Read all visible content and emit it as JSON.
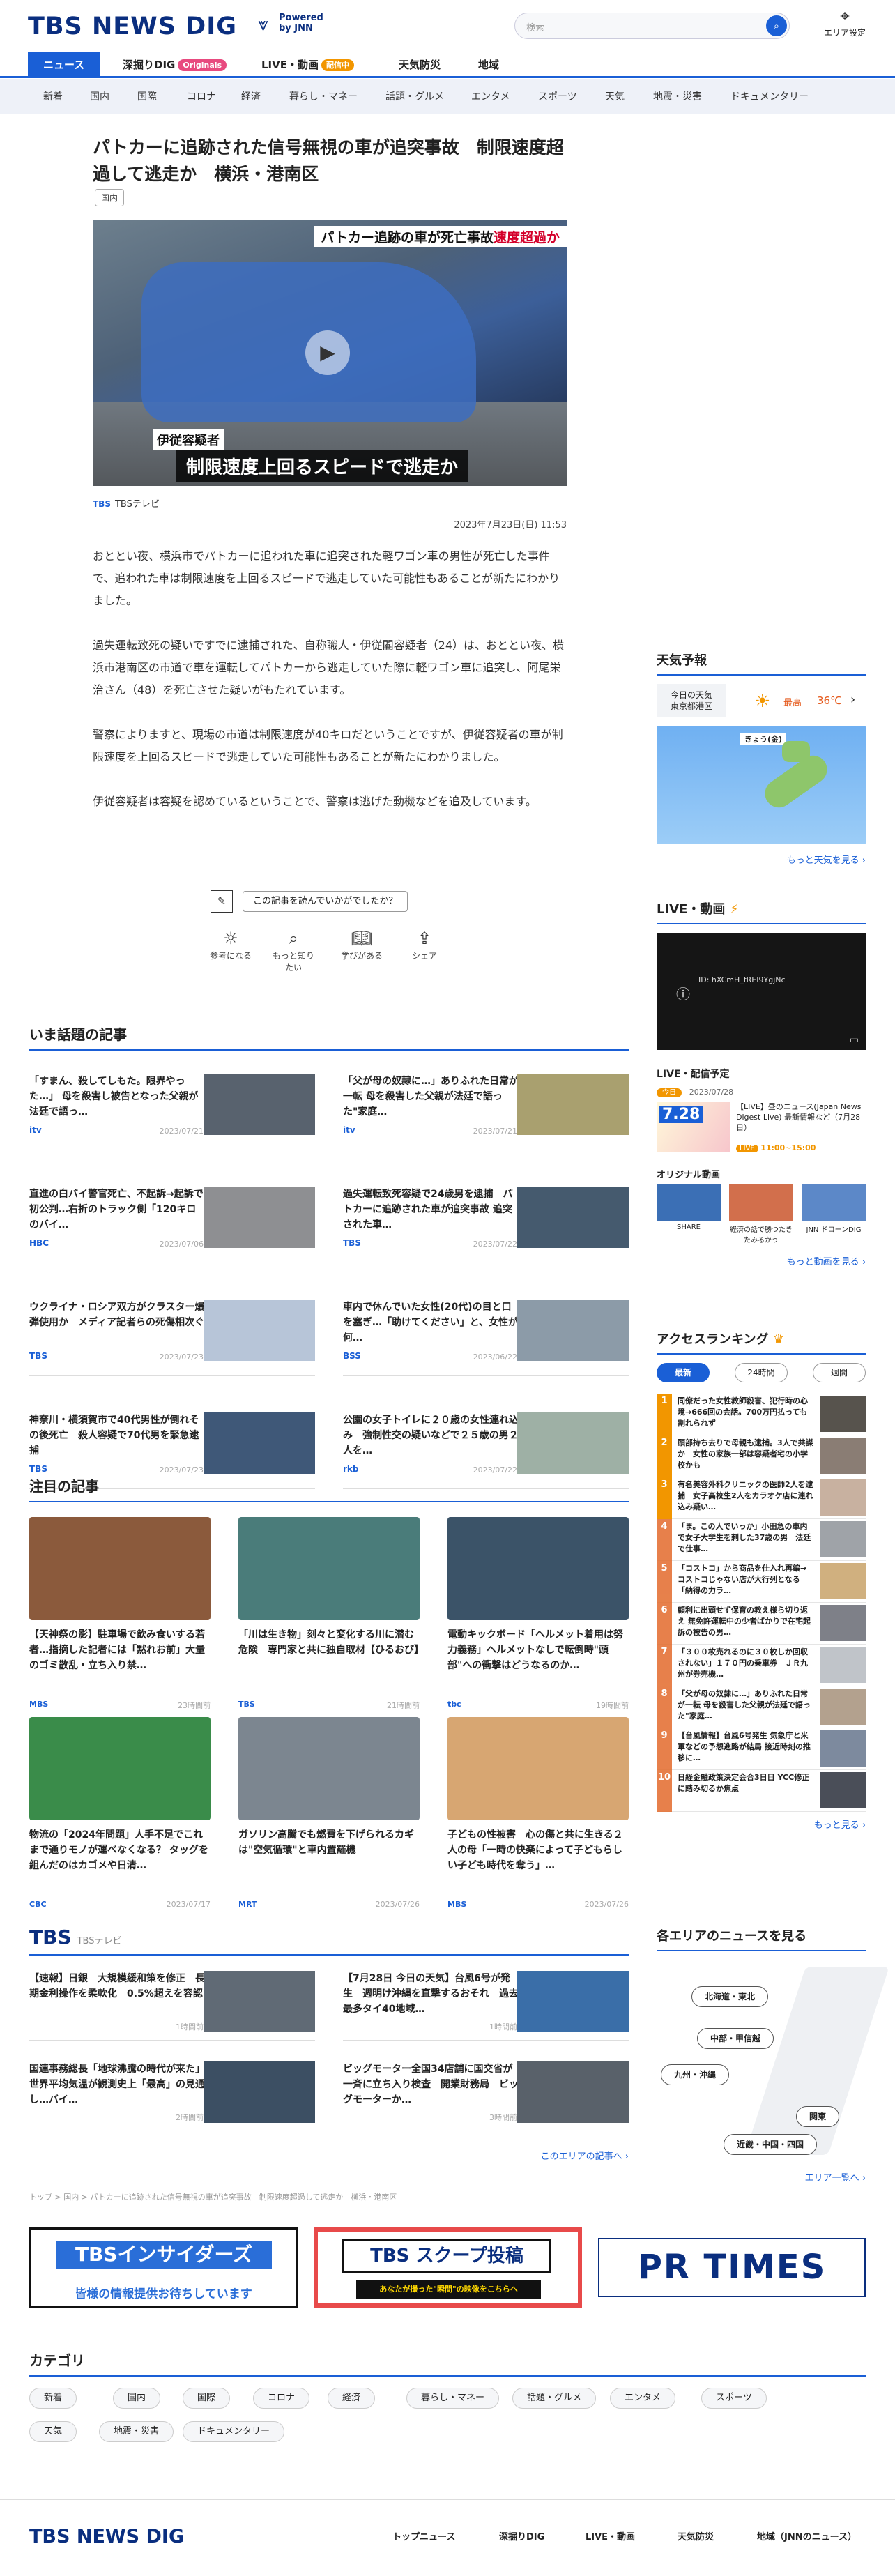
{
  "header": {
    "logo": "TBS NEWS DIG",
    "powered": "Powered",
    "by": "by JNN",
    "search_placeholder": "検索",
    "area_setting": "エリア設定"
  },
  "nav_primary": [
    "ニュース",
    "深掘りDIG",
    "Originals",
    "LIVE・動画",
    "配信中",
    "天気防災",
    "地域"
  ],
  "nav_secondary": [
    "新着",
    "国内",
    "国際",
    "コロナ",
    "経済",
    "暮らし・マネー",
    "話題・グルメ",
    "エンタメ",
    "スポーツ",
    "天気",
    "地震・災害",
    "ドキュメンタリー"
  ],
  "article": {
    "title": "パトカーに追跡された信号無視の車が追突事故　制限速度超過して逃走か　横浜・港南区",
    "tag": "国内",
    "hero_caption_top": "パトカー追跡の車が死亡事故",
    "hero_caption_top_red": "速度超過か",
    "hero_caption_name": "伊従容疑者",
    "hero_caption_main": "制限速度上回るスピードで逃走か",
    "source_logo": "TBS",
    "source": "TBSテレビ",
    "date": "2023年7月23日(日) 11:53",
    "paragraphs": [
      "おととい夜、横浜市でパトカーに追われた車に追突された軽ワゴン車の男性が死亡した事件で、追われた車は制限速度を上回るスピードで逃走していた可能性もあることが新たにわかりました。",
      "過失運転致死の疑いですでに逮捕された、自称職人・伊従閣容疑者（24）は、おととい夜、横浜市港南区の市道で車を運転してパトカーから逃走していた際に軽ワゴン車に追突し、阿尾栄治さん（48）を死亡させた疑いがもたれています。",
      "警察によりますと、現場の市道は制限速度が40キロだということですが、伊従容疑者の車が制限速度を上回るスピードで逃走していた可能性もあることが新たにわかりました。",
      "伊従容疑者は容疑を認めているということで、警察は逃げた動機などを追及しています。"
    ],
    "rating_prompt": "この記事を読んでいかがでしたか？",
    "rating_buttons": [
      "参考になる",
      "もっと知りたい",
      "学びがある",
      "シェア"
    ]
  },
  "trending": {
    "title": "いま話題の記事",
    "items": [
      {
        "title": "「すまん、殺してしもた。限界やった…」 母を殺害し被告となった父親が法廷で語っ…",
        "logo": "itv",
        "date": "2023/07/21"
      },
      {
        "title": "「父が母の奴隷に…」ありふれた日常が一転 母を殺害した父親が法廷で語った\"家庭…",
        "logo": "itv",
        "date": "2023/07/21"
      },
      {
        "title": "直進の白バイ警官死亡、不起訴→起訴で初公判…右折のトラック側「120キロのバイ…",
        "logo": "HBC",
        "date": "2023/07/06"
      },
      {
        "title": "過失運転致死容疑で24歳男を逮捕　パトカーに追跡された車が追突事故 追突された車…",
        "logo": "TBS",
        "date": "2023/07/22"
      },
      {
        "title": "ウクライナ・ロシア双方がクラスター爆弾使用か　メディア記者らの死傷相次ぐ",
        "logo": "TBS",
        "date": "2023/07/23"
      },
      {
        "title": "車内で休んでいた女性(20代)の目と口を塞ぎ…「助けてください」と、女性が何…",
        "logo": "BSS",
        "date": "2023/06/22"
      },
      {
        "title": "神奈川・横須賀市で40代男性が倒れその後死亡　殺人容疑で70代男を緊急逮捕",
        "logo": "TBS",
        "date": "2023/07/23"
      },
      {
        "title": "公園の女子トイレに２０歳の女性連れ込み　強制性交の疑いなどで２５歳の男２人を…",
        "logo": "rkb",
        "date": "2023/07/22"
      }
    ]
  },
  "featured": {
    "title": "注目の記事",
    "items": [
      {
        "title": "【天神祭の影】駐車場で飲み食いする若者…指摘した記者には「黙れお前」大量のゴミ散乱・立ち入り禁…",
        "logo": "MBS",
        "time": "23時間前"
      },
      {
        "title": "「川は生き物」刻々と変化する川に潜む危険　専門家と共に独自取材【ひるおび】",
        "logo": "TBS",
        "time": "21時間前"
      },
      {
        "title": "電動キックボード「ヘルメット着用は努力義務」ヘルメットなしで転倒時\"頭部\"への衝撃はどうなるのか…",
        "logo": "tbc",
        "time": "19時間前"
      },
      {
        "title": "物流の「2024年問題」人手不足でこれまで通りモノが運べなくなる？ タッグを組んだのはカゴメや日清…",
        "logo": "CBC",
        "date": "2023/07/17"
      },
      {
        "title": "ガソリン高騰でも燃費を下げられるカギは\"空気循環\"と車内置羅機",
        "logo": "MRT",
        "date": "2023/07/26"
      },
      {
        "title": "子どもの性被害　心の傷と共に生きる２人の母「一時の快楽によって子どもらしい子ども時代を奪う」…",
        "logo": "MBS",
        "date": "2023/07/26"
      }
    ]
  },
  "local": {
    "logo": "TBS",
    "station": "TBSテレビ",
    "items": [
      {
        "title": "【速報】日銀　大規模緩和策を修正　長期金利操作を柔軟化　0.5%超えを容認",
        "time": "1時間前"
      },
      {
        "title": "【7月28日 今日の天気】台風6号が発生　週明け沖縄を直撃するおそれ　過去最多タイ40地域…",
        "time": "1時間前"
      },
      {
        "title": "国連事務総長「地球沸騰の時代が来た」 世界平均気温が観測史上「最高」の見通し…バイ…",
        "time": "2時間前"
      },
      {
        "title": "ビッグモーター全国34店舗に国交省が一斉に立ち入り検査　開業財務局　ビッグモーターか…",
        "time": "3時間前"
      }
    ],
    "more": "このエリアの記事へ"
  },
  "breadcrumb": "トップ > 国内 > パトカーに追跡された信号無視の車が追突事故　制限速度超過して逃走か　横浜・港南区",
  "banners": {
    "insiders": "TBSインサイダーズ",
    "insiders_sub": "皆様の情報提供お待ちしています",
    "scoop": "TBS スクープ投稿",
    "scoop_sub": "あなたが撮った\"瞬間\"の映像をこちらへ",
    "prtimes": "PR TIMES"
  },
  "categories": {
    "title": "カテゴリ",
    "items": [
      "新着",
      "国内",
      "国際",
      "コロナ",
      "経済",
      "暮らし・マネー",
      "話題・グルメ",
      "エンタメ",
      "スポーツ",
      "天気",
      "地震・災害",
      "ドキュメンタリー"
    ]
  },
  "footer": {
    "logo": "TBS NEWS DIG",
    "links": [
      "トップニュース",
      "深掘りDIG",
      "LIVE・動画",
      "天気防災",
      "地域（JNNのニュース）"
    ]
  },
  "weather": {
    "title": "天気予報",
    "today": "今日の天気",
    "place": "東京都港区",
    "temp_label": "最高",
    "temp": "36℃",
    "map_label": "きょう(金)",
    "more": "もっと天気を見る"
  },
  "live": {
    "title": "LIVE・動画",
    "video_text": "ID: hXCmH_fREI9YgjNc",
    "schedule_title": "LIVE・配信予定",
    "today_badge": "今日",
    "date": "2023/07/28",
    "thumb_date": "7.28",
    "item_title": "【LIVE】昼のニュース(Japan News Digest Live) 最新情報など（7月28日）",
    "live_badge": "LIVE",
    "time": "11:00~15:00",
    "original_title": "オリジナル動画",
    "originals": [
      "SHARE",
      "経済の話で勝つたきたみるかう",
      "JNN ドローンDIG"
    ],
    "more": "もっと動画を見る"
  },
  "ranking": {
    "title": "アクセスランキング",
    "tabs": [
      "最新",
      "24時間",
      "週間"
    ],
    "items": [
      "同僚だった女性教師殺害、犯行時の心境→666回の会話。700万円払っても割れられず",
      "頭部持ち去りで母親も逮捕。3人で共謀か　女性の家族一部は容疑者宅の小学校かも",
      "有名美容外科クリニックの医師2人を逮捕　女子高校生2人をカラオケ店に連れ込み疑い…",
      "「ま。この人でいっか」小田急の車内で女子大学生を刺した37歳の男　法廷で仕事…",
      "「コストコ」から商品を仕入れ再編→コストコじゃない店が大行列となる「納得の力ラ…",
      "顧利に出頭せず保育の教え様ら切り返え 無免許運転中の少者ばかりで在宅起訴の被告の男…",
      "「３００枚売れるのに３０枚しか回収されない」１７０円の乗車券　ＪＲ九州が券売機…",
      "「父が母の奴隷に…」ありふれた日常が一転 母を殺害した父親が法廷で語った\"家庭…",
      "【台風情報】台風6号発生 気象庁と米軍などの予想進路が結局 接近時刻の推移に…",
      "日経金融政策決定会合3日目 YCC修正に踏み切るか焦点"
    ],
    "more": "もっと見る"
  },
  "areas": {
    "title": "各エリアのニュースを見る",
    "buttons": [
      "北海道・東北",
      "中部・甲信越",
      "九州・沖縄",
      "関東",
      "近畿・中国・四国"
    ],
    "more": "エリア一覧へ"
  },
  "colors": {
    "brand": "#0a2e7f",
    "accent": "#1a5fd6",
    "live": "#f29600",
    "rank1": "#f29600",
    "rank_other": "#e36b2c"
  }
}
